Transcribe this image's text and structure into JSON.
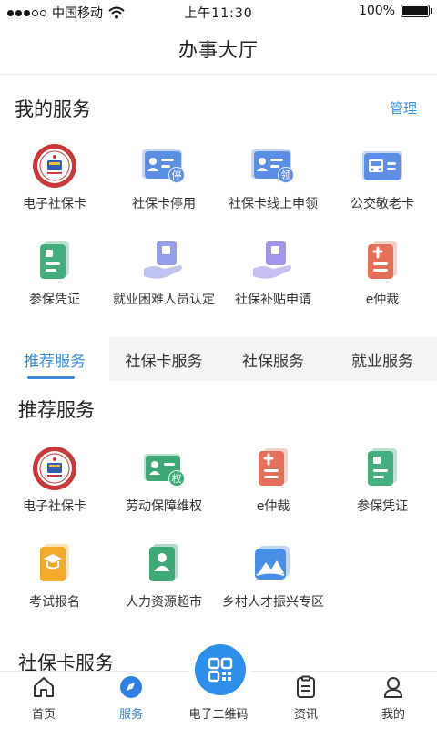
{
  "status_bar": {
    "carrier": "中国移动",
    "time": "上午11:30",
    "battery": "100%",
    "battery_level": 1.0
  },
  "nav": {
    "title": "办事大厅"
  },
  "my_services": {
    "title": "我的服务",
    "manage": "管理",
    "items": [
      {
        "label": "电子社保卡",
        "icon": "social-security-seal-icon"
      },
      {
        "label": "社保卡停用",
        "icon": "card-stop-icon",
        "badge": "停"
      },
      {
        "label": "社保卡线上申领",
        "icon": "card-apply-icon",
        "badge": "领"
      },
      {
        "label": "公交敬老卡",
        "icon": "bus-card-icon"
      },
      {
        "label": "参保凭证",
        "icon": "certificate-icon"
      },
      {
        "label": "就业困难人员认定",
        "icon": "hand-document-icon"
      },
      {
        "label": "社保补贴申请",
        "icon": "hand-document-purple-icon"
      },
      {
        "label": "e仲裁",
        "icon": "arbitration-icon"
      }
    ]
  },
  "tabs": [
    "推荐服务",
    "社保卡服务",
    "社保服务",
    "就业服务"
  ],
  "recommended": {
    "title": "推荐服务",
    "items": [
      {
        "label": "电子社保卡",
        "icon": "social-security-seal-icon"
      },
      {
        "label": "劳动保障维权",
        "icon": "labor-rights-icon",
        "badge": "权"
      },
      {
        "label": "e仲裁",
        "icon": "arbitration-icon"
      },
      {
        "label": "参保凭证",
        "icon": "certificate-icon"
      },
      {
        "label": "考试报名",
        "icon": "exam-icon"
      },
      {
        "label": "人力资源超市",
        "icon": "hr-market-icon"
      },
      {
        "label": "乡村人才振兴专区",
        "icon": "village-talent-icon"
      }
    ]
  },
  "next_section": {
    "title": "社保卡服务"
  },
  "bottom_nav": {
    "items": [
      {
        "label": "首页",
        "icon": "home-icon"
      },
      {
        "label": "服务",
        "icon": "compass-icon"
      },
      {
        "label": "电子二维码",
        "icon": "qr-code-icon"
      },
      {
        "label": "资讯",
        "icon": "news-icon"
      },
      {
        "label": "我的",
        "icon": "user-icon"
      }
    ],
    "active_index": 1
  },
  "colors": {
    "accent": "#2f8ee8",
    "tab_bg": "#f4f5f7"
  },
  "seal_text": "SOCIAL SECURITY CARD"
}
